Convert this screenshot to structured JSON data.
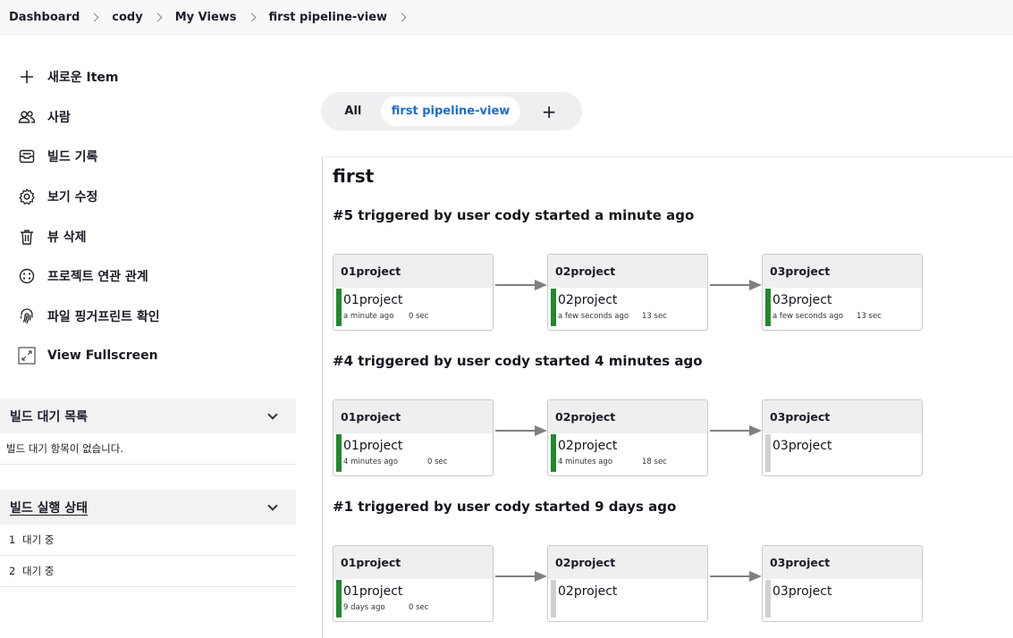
{
  "breadcrumb": [
    "Dashboard",
    "cody",
    "My Views",
    "first pipeline-view"
  ],
  "tasks": [
    {
      "label": "새로운 Item",
      "icon": "plus-icon"
    },
    {
      "label": "사람",
      "icon": "people-icon"
    },
    {
      "label": "빌드 기록",
      "icon": "inbox-icon"
    },
    {
      "label": "보기 수정",
      "icon": "gear-icon"
    },
    {
      "label": "뷰 삭제",
      "icon": "trash-icon"
    },
    {
      "label": "프로젝트 연관 관계",
      "icon": "relation-icon"
    },
    {
      "label": "파일 핑거프린트 확인",
      "icon": "fingerprint-icon"
    },
    {
      "label": "View Fullscreen",
      "icon": "fullscreen-icon"
    }
  ],
  "queue": {
    "title": "빌드 대기 목록",
    "empty": "빌드 대기 항목이 없습니다."
  },
  "executors": {
    "title": "빌드 실행 상태",
    "rows": [
      {
        "num": "1",
        "status": "대기 중"
      },
      {
        "num": "2",
        "status": "대기 중"
      }
    ]
  },
  "tabs": {
    "all": "All",
    "active": "first pipeline-view",
    "add": "+"
  },
  "view": {
    "title": "first"
  },
  "builds": [
    {
      "heading": "#5 triggered by user cody started a minute ago",
      "stages": [
        {
          "header": "01project",
          "job": "01project",
          "status": "success",
          "when": "a minute ago",
          "duration": "0 sec"
        },
        {
          "header": "02project",
          "job": "02project",
          "status": "success",
          "when": "a few seconds ago",
          "duration": "13 sec"
        },
        {
          "header": "03project",
          "job": "03project",
          "status": "success",
          "when": "a few seconds ago",
          "duration": "13 sec"
        }
      ]
    },
    {
      "heading": "#4 triggered by user cody started 4 minutes ago",
      "stages": [
        {
          "header": "01project",
          "job": "01project",
          "status": "success",
          "when": "4 minutes ago",
          "duration": "0 sec"
        },
        {
          "header": "02project",
          "job": "02project",
          "status": "success",
          "when": "4 minutes ago",
          "duration": "18 sec"
        },
        {
          "header": "03project",
          "job": "03project",
          "status": "not-built",
          "when": "",
          "duration": ""
        }
      ]
    },
    {
      "heading": "#1 triggered by user cody started 9 days ago",
      "stages": [
        {
          "header": "01project",
          "job": "01project",
          "status": "success",
          "when": "9 days ago",
          "duration": "0 sec"
        },
        {
          "header": "02project",
          "job": "02project",
          "status": "not-built",
          "when": "",
          "duration": ""
        },
        {
          "header": "03project",
          "job": "03project",
          "status": "not-built",
          "when": "",
          "duration": ""
        }
      ]
    }
  ],
  "colors": {
    "success": "#1f8a2a",
    "not_built": "#d0d0d3",
    "accent": "#1a6dd6"
  }
}
